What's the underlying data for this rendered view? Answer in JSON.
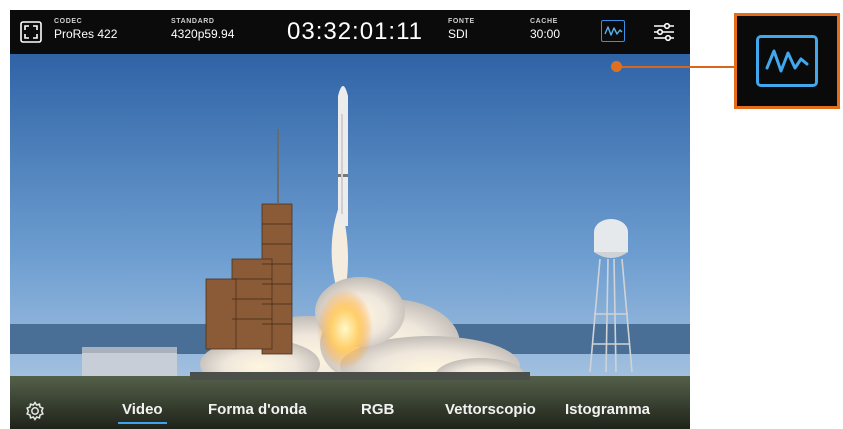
{
  "topbar": {
    "codec": {
      "label": "CODEC",
      "value": "ProRes 422"
    },
    "standard": {
      "label": "STANDARD",
      "value": "4320p59.94"
    },
    "timecode": "03:32:01:11",
    "source": {
      "label": "FONTE",
      "value": "SDI"
    },
    "cache": {
      "label": "CACHE",
      "value": "30:00"
    }
  },
  "tabs": [
    {
      "label": "Video",
      "active": true
    },
    {
      "label": "Forma d'onda",
      "active": false
    },
    {
      "label": "RGB",
      "active": false
    },
    {
      "label": "Vettorscopio",
      "active": false
    },
    {
      "label": "Istogramma",
      "active": false
    }
  ],
  "icons": {
    "fullscreen": "fullscreen-icon",
    "scopes": "waveform-icon",
    "settings": "sliders-icon",
    "gear": "gear-icon"
  },
  "colors": {
    "accent_blue": "#3fa1f0",
    "callout_orange": "#e36d1d"
  }
}
